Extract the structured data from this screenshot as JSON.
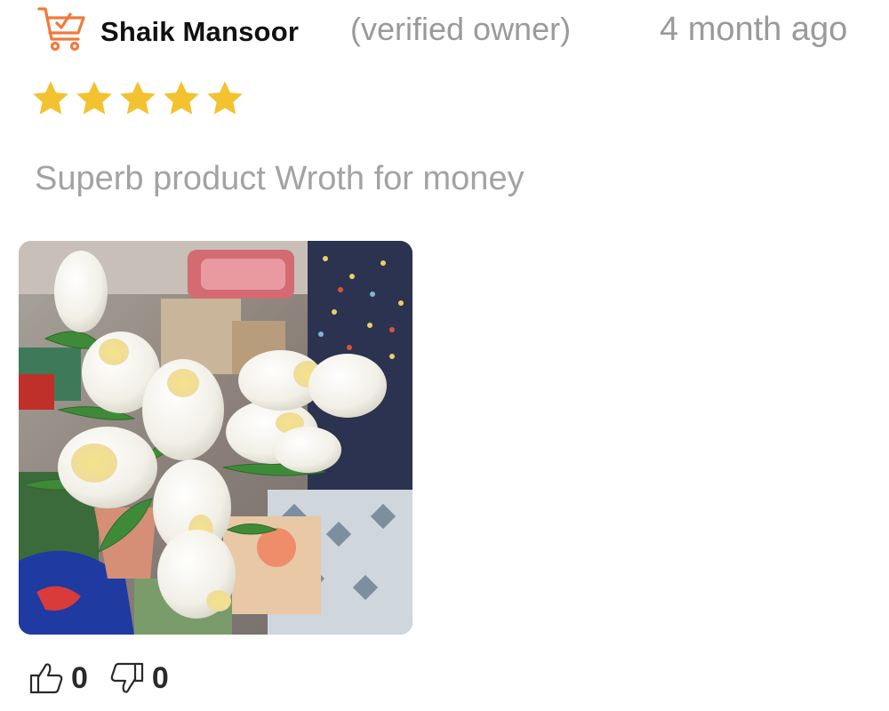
{
  "review": {
    "reviewer_name": "Shaik Mansoor",
    "verified_label": "(verified owner)",
    "date": "4 month ago",
    "rating": 5,
    "rating_max": 5,
    "text": "Superb product Wroth for money",
    "photo_alt": "White tulips",
    "likes": "0",
    "dislikes": "0"
  },
  "icons": {
    "cart": "shopping-cart-check-icon",
    "star": "star-icon",
    "like": "thumbs-up-icon",
    "dislike": "thumbs-down-icon"
  },
  "colors": {
    "cart_icon": "#f07a3a",
    "star": "#f2c230",
    "muted_text": "#9a9a9a",
    "name_text": "#111111"
  }
}
